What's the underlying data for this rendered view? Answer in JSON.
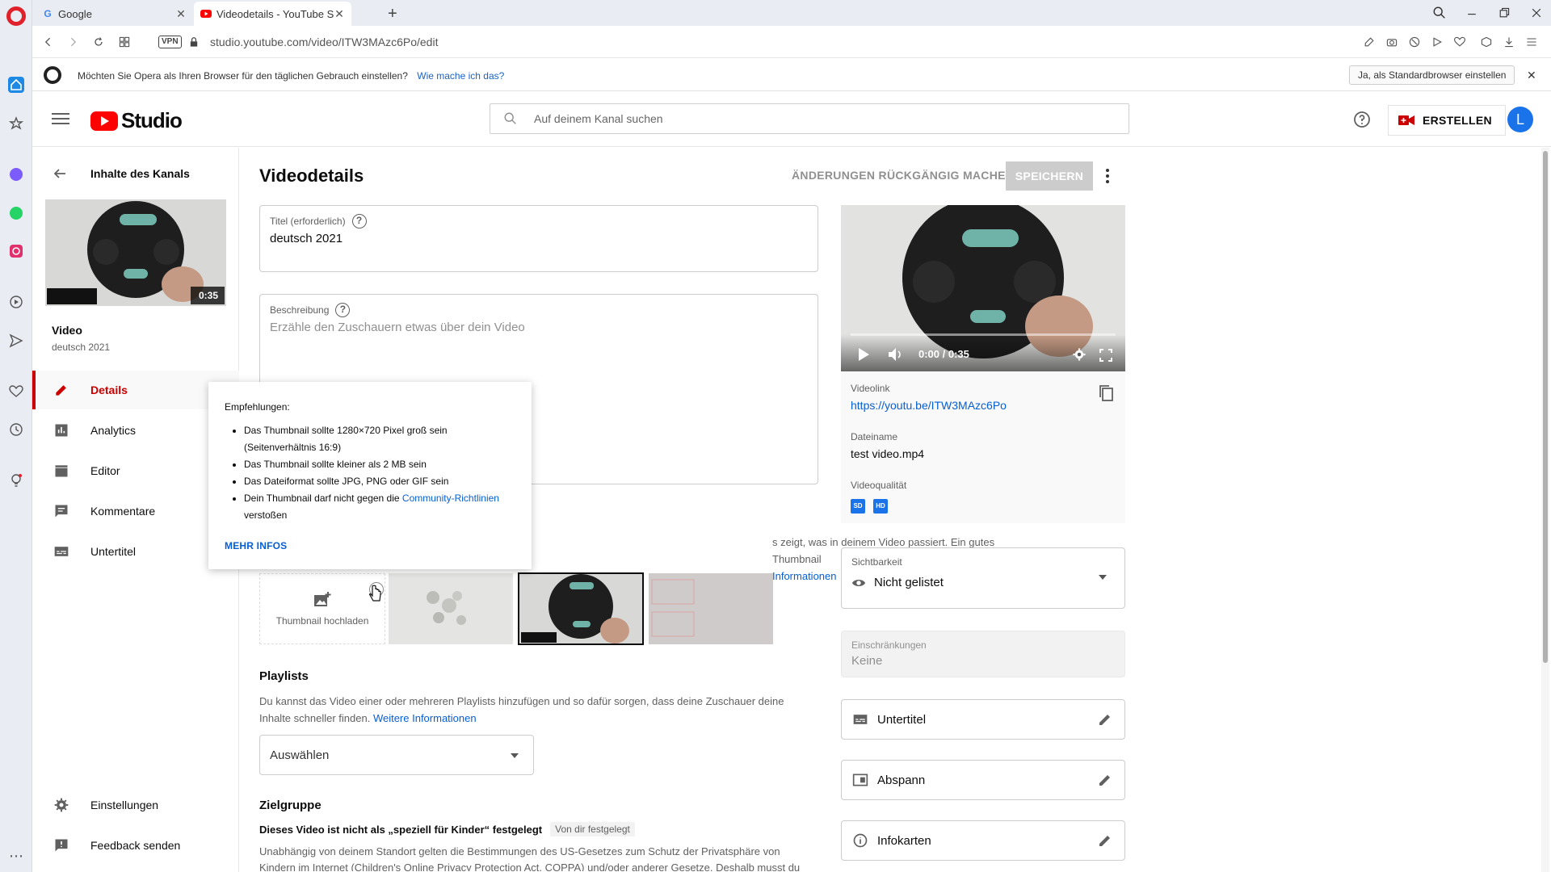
{
  "browser": {
    "tabs": [
      {
        "label": "Google"
      },
      {
        "label": "Videodetails - YouTube Stu"
      }
    ],
    "url": "studio.youtube.com/video/ITW3MAzc6Po/edit",
    "vpn_label": "VPN",
    "notification": {
      "message": "Möchten Sie Opera als Ihren Browser für den täglichen Gebrauch einstellen?",
      "link": "Wie mache ich das?",
      "button": "Ja, als Standardbrowser einstellen"
    }
  },
  "header": {
    "logo_text": "Studio",
    "search_placeholder": "Auf deinem Kanal suchen",
    "create_label": "ERSTELLEN",
    "avatar_letter": "L"
  },
  "sidebar": {
    "back_label": "Inhalte des Kanals",
    "thumb_duration": "0:35",
    "video_label": "Video",
    "video_title": "deutsch 2021",
    "items": [
      {
        "label": "Details"
      },
      {
        "label": "Analytics"
      },
      {
        "label": "Editor"
      },
      {
        "label": "Kommentare"
      },
      {
        "label": "Untertitel"
      }
    ],
    "bottom_items": [
      {
        "label": "Einstellungen"
      },
      {
        "label": "Feedback senden"
      }
    ]
  },
  "main": {
    "title": "Videodetails",
    "undo_label": "ÄNDERUNGEN RÜCKGÄNGIG MACHEN",
    "save_label": "SPEICHERN",
    "title_field": {
      "label": "Titel (erforderlich)",
      "value": "deutsch 2021"
    },
    "description_field": {
      "label": "Beschreibung",
      "placeholder": "Erzähle den Zuschauern etwas über dein Video"
    },
    "thumbnail": {
      "desc_part1": "s zeigt, was in deinem Video passiert. Ein gutes Thumbnail",
      "desc_link": "Informationen",
      "upload_label": "Thumbnail hochladen"
    },
    "playlists": {
      "title": "Playlists",
      "text": "Du kannst das Video einer oder mehreren Playlists hinzufügen und so dafür sorgen, dass deine Zuschauer deine Inhalte schneller finden.",
      "link": "Weitere Informationen",
      "select_value": "Auswählen"
    },
    "audience": {
      "title": "Zielgruppe",
      "status": "Dieses Video ist nicht als „speziell für Kinder“ festgelegt",
      "chip": "Von dir festgelegt",
      "text": "Unabhängig von deinem Standort gelten die Bestimmungen des US-Gesetzes zum Schutz der Privatsphäre von Kindern im Internet (Children's Online Privacy Protection Act, COPPA) und/oder anderer Gesetze. Deshalb musst du angeben, ob"
    }
  },
  "popup": {
    "title": "Empfehlungen:",
    "bullets": [
      "Das Thumbnail sollte 1280×720 Pixel groß sein (Seitenverhältnis 16:9)",
      "Das Thumbnail sollte kleiner als 2 MB sein",
      "Das Dateiformat sollte JPG, PNG oder GIF sein"
    ],
    "last_bullet_pre": "Dein Thumbnail darf nicht gegen die",
    "last_bullet_link": "Community-Richtlinien",
    "last_bullet_post": "verstoßen",
    "more": "MEHR INFOS"
  },
  "right": {
    "player_time": "0:00 / 0:35",
    "videolink_label": "Videolink",
    "videolink": "https://youtu.be/ITW3MAzc6Po",
    "filename_label": "Dateiname",
    "filename": "test video.mp4",
    "quality_label": "Videoqualität",
    "quality_badges": [
      "SD",
      "HD"
    ],
    "visibility_label": "Sichtbarkeit",
    "visibility_value": "Nicht gelistet",
    "restrictions_label": "Einschränkungen",
    "restrictions_value": "Keine",
    "rows": [
      {
        "label": "Untertitel"
      },
      {
        "label": "Abspann"
      },
      {
        "label": "Infokarten"
      }
    ]
  },
  "colors": {
    "brand_red": "#ff0000",
    "active_red": "#cc0000",
    "link_blue": "#065fd4",
    "avatar_blue": "#1a73e8"
  }
}
